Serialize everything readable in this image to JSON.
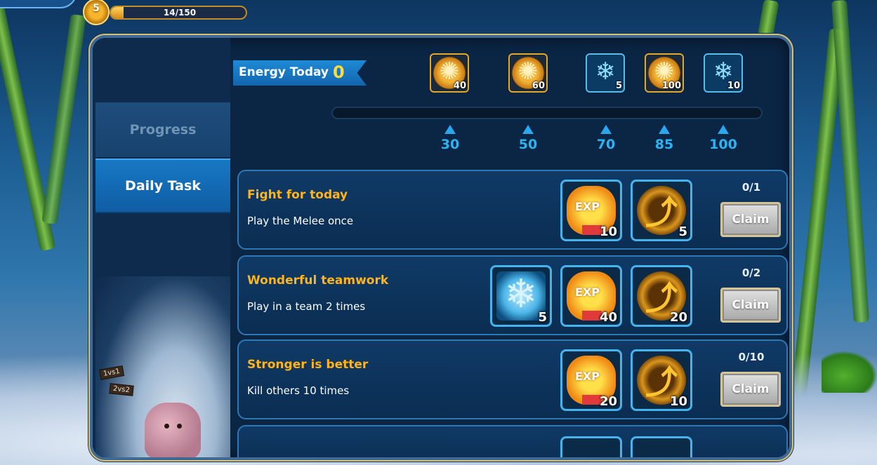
{
  "player": {
    "level": "5",
    "xp_text": "14/150",
    "xp_fraction": 0.093
  },
  "tabs": [
    {
      "label": "Progress",
      "active": false
    },
    {
      "label": "Daily Task",
      "active": true
    }
  ],
  "scene_signs": [
    "1vs1",
    "2vs2"
  ],
  "energy": {
    "label": "Energy Today",
    "value": "0",
    "fill_fraction": 0,
    "milestones": [
      {
        "threshold": "30",
        "reward_icon": "coin-icon",
        "reward_count": "40"
      },
      {
        "threshold": "50",
        "reward_icon": "coin-icon",
        "reward_count": "60"
      },
      {
        "threshold": "70",
        "reward_icon": "snowflake-icon",
        "reward_count": "5"
      },
      {
        "threshold": "85",
        "reward_icon": "coin-icon",
        "reward_count": "100"
      },
      {
        "threshold": "100",
        "reward_icon": "snowflake-icon",
        "reward_count": "10"
      }
    ]
  },
  "tasks": [
    {
      "title": "Fight for today",
      "description": "Play the Melee once",
      "progress": "0/1",
      "claim_label": "Claim",
      "rewards": [
        {
          "type": "exp",
          "icon": "exp-star-icon",
          "label": "EXP",
          "count": "10"
        },
        {
          "type": "arrow",
          "icon": "gold-arrow-icon",
          "count": "5"
        }
      ]
    },
    {
      "title": "Wonderful teamwork",
      "description": "Play in a team 2 times",
      "progress": "0/2",
      "claim_label": "Claim",
      "rewards": [
        {
          "type": "snow",
          "icon": "snowflake-icon",
          "count": "5"
        },
        {
          "type": "exp",
          "icon": "exp-star-icon",
          "label": "EXP",
          "count": "40"
        },
        {
          "type": "arrow",
          "icon": "gold-arrow-icon",
          "count": "20"
        }
      ]
    },
    {
      "title": "Stronger is better",
      "description": "Kill others 10 times",
      "progress": "0/10",
      "claim_label": "Claim",
      "rewards": [
        {
          "type": "exp",
          "icon": "exp-star-icon",
          "label": "EXP",
          "count": "20"
        },
        {
          "type": "arrow",
          "icon": "gold-arrow-icon",
          "count": "10"
        }
      ]
    }
  ],
  "colors": {
    "task_title": "#ffb419",
    "energy_value": "#ffdb3a",
    "marker": "#2ab4f4",
    "active_tab": "#1778c4"
  }
}
